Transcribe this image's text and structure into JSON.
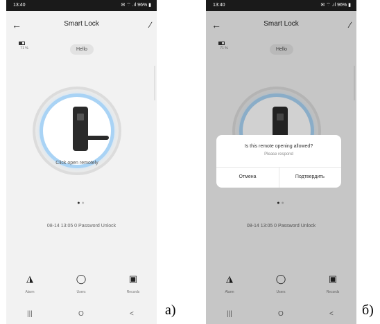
{
  "panels": [
    {
      "status_time": "13:40",
      "status_right": "✉ ⌔ .ıl 96% ▮",
      "title": "Smart Lock",
      "battery": "71 %",
      "greeting": "Hello",
      "lock_action": "Click open remotely",
      "log_entry": "08-14 13:05  0 Password Unlock",
      "tabs": [
        "Alarm",
        "Users",
        "Records"
      ],
      "label": "a)"
    },
    {
      "status_time": "13:40",
      "status_right": "✉ ⌔ .ıl 96% ▮",
      "title": "Smart Lock",
      "battery": "71 %",
      "greeting": "Hello",
      "log_entry": "08-14 13:05  0 Password Unlock",
      "tabs": [
        "Alarm",
        "Users",
        "Records"
      ],
      "dialog": {
        "title": "Is this remote opening allowed?",
        "subtitle": "Please respond",
        "cancel": "Отмена",
        "confirm": "Подтвердить"
      },
      "label": "б)"
    }
  ],
  "icons": {
    "back": "arrow-left",
    "edit": "pencil",
    "alarm": "alarm-light",
    "users": "users",
    "records": "calendar",
    "nav_recents": "|||",
    "nav_home": "O",
    "nav_back": "<"
  },
  "colors": {
    "accent_ring": "#a9d3f5",
    "background": "#f2f2f2",
    "status_bar": "#1a1a1a"
  }
}
